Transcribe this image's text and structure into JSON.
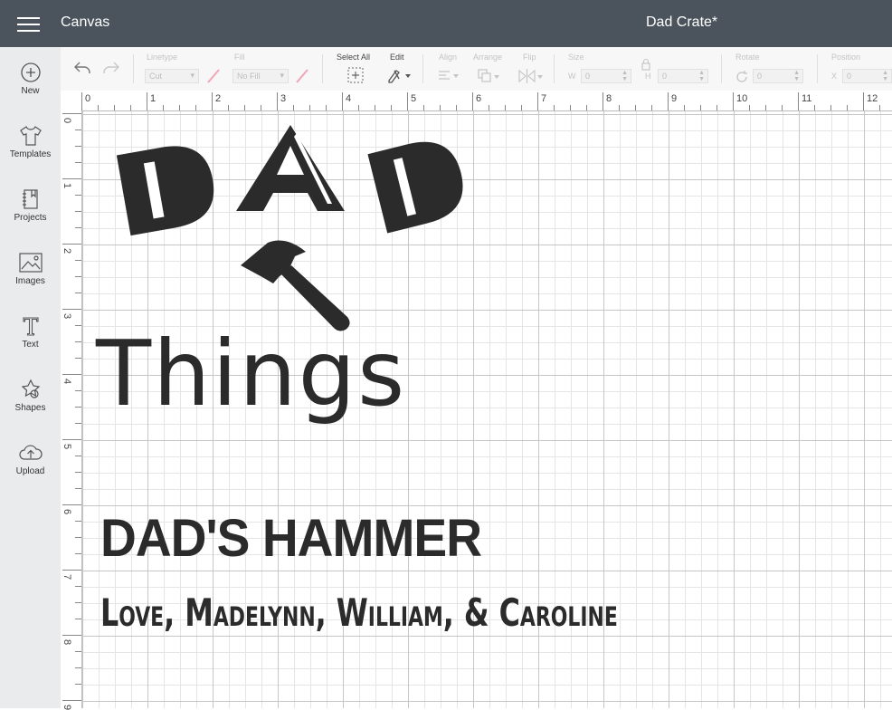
{
  "header": {
    "brand": "Canvas",
    "doc_title": "Dad Crate*"
  },
  "sidebar": {
    "items": [
      {
        "label": "New",
        "icon": "plus-circle-icon"
      },
      {
        "label": "Templates",
        "icon": "shirt-icon"
      },
      {
        "label": "Projects",
        "icon": "notebook-icon"
      },
      {
        "label": "Images",
        "icon": "image-icon"
      },
      {
        "label": "Text",
        "icon": "text-t-icon"
      },
      {
        "label": "Shapes",
        "icon": "shapes-icon"
      },
      {
        "label": "Upload",
        "icon": "cloud-upload-icon"
      }
    ]
  },
  "toolbar": {
    "linetype_label": "Linetype",
    "linetype_value": "Cut",
    "fill_label": "Fill",
    "fill_value": "No Fill",
    "select_all_label": "Select All",
    "edit_label": "Edit",
    "align_label": "Align",
    "arrange_label": "Arrange",
    "flip_label": "Flip",
    "size_label": "Size",
    "w_label": "W",
    "w_value": "0",
    "h_label": "H",
    "h_value": "0",
    "rotate_label": "Rotate",
    "rotate_value": "0",
    "position_label": "Position",
    "x_label": "X",
    "x_value": "0"
  },
  "ruler": {
    "top": [
      "0",
      "1",
      "2",
      "3",
      "4",
      "5",
      "6",
      "7",
      "8",
      "9",
      "10",
      "11",
      "12"
    ],
    "left": [
      "0",
      "1",
      "2",
      "3",
      "4",
      "5",
      "6",
      "7",
      "8",
      "9"
    ]
  },
  "design": {
    "line1": "DAD",
    "line2": "Things",
    "line3": "DAD'S HAMMER",
    "line4": "Love, Madelynn, William, & Caroline"
  }
}
